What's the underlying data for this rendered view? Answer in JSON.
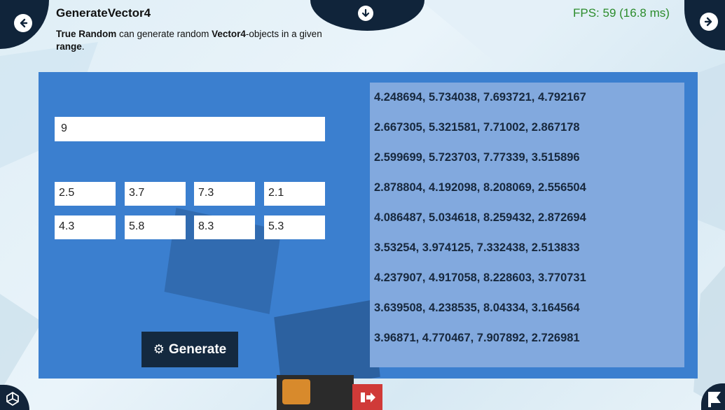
{
  "header": {
    "title": "GenerateVector4",
    "description_parts": [
      {
        "text": "True Random",
        "bold": true
      },
      {
        "text": " can generate random ",
        "bold": false
      },
      {
        "text": "Vector4",
        "bold": true
      },
      {
        "text": "-objects in a given ",
        "bold": false
      },
      {
        "text": "range",
        "bold": true
      },
      {
        "text": ".",
        "bold": false
      }
    ],
    "fps": "FPS: 59 (16.8 ms)"
  },
  "icons": {
    "back": "arrow-left-circle-icon",
    "forward": "arrow-right-circle-icon",
    "down": "arrow-down-circle-icon",
    "unity": "unity-logo-icon",
    "exit": "exit-icon",
    "right_logo": "flag-logo-icon",
    "gear": "gear-icon"
  },
  "colors": {
    "panel": "#3b7fcf",
    "output": "#82a9de",
    "dark": "#10243a",
    "fps": "#2c8c2c",
    "exit": "#d03a38"
  },
  "form": {
    "count": "9",
    "min": [
      "2.5",
      "3.7",
      "7.3",
      "2.1"
    ],
    "max": [
      "4.3",
      "5.8",
      "8.3",
      "5.3"
    ],
    "generate_label": "Generate"
  },
  "output": {
    "lines": [
      "4.248694, 5.734038, 7.693721, 4.792167",
      "2.667305, 5.321581, 7.71002, 2.867178",
      "2.599699, 5.723703, 7.77339, 3.515896",
      "2.878804, 4.192098, 8.208069, 2.556504",
      "4.086487, 5.034618, 8.259432, 2.872694",
      "3.53254, 3.974125, 7.332438, 2.513833",
      "4.237907, 4.917058, 8.228603, 3.770731",
      "3.639508, 4.238535, 8.04334, 3.164564",
      "3.96871, 4.770467, 7.907892, 2.726981"
    ]
  }
}
